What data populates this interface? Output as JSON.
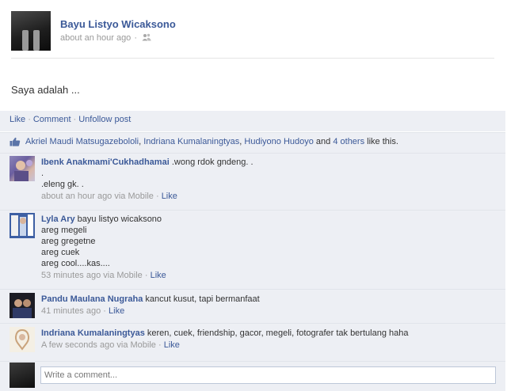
{
  "post": {
    "author": "Bayu Listyo Wicaksono",
    "timestamp": "about an hour ago",
    "meta_separator": "·",
    "audience_icon": "friends-icon",
    "text": "Saya adalah ..."
  },
  "actions": {
    "like": "Like",
    "comment": "Comment",
    "unfollow": "Unfollow post",
    "separator": "·"
  },
  "likes": {
    "icon": "thumbs-up-icon",
    "person1": "Akriel Maudi Matsugazebololi",
    "comma1": ",",
    "person2": "Indriana Kumalaningtyas",
    "comma2": ",",
    "person3": "Hudiyono Hudoyo",
    "and": "and",
    "others": "4 others",
    "suffix": "like this."
  },
  "comments": [
    {
      "author": "Ibenk Anakmami'Cukhadhamai",
      "text": ".wong rdok gndeng. .\n.\n.eleng gk. .",
      "time": "about an hour ago via Mobile",
      "sep": "·",
      "like": "Like"
    },
    {
      "author": "Lyla Ary",
      "text": "bayu listyo wicaksono\nareg megeli\nareg gregetne\nareg cuek\nareg cool....kas....",
      "time": "53 minutes ago via Mobile",
      "sep": "·",
      "like": "Like"
    },
    {
      "author": "Pandu Maulana Nugraha",
      "text": "kancut kusut, tapi bermanfaat",
      "time": "41 minutes ago",
      "sep": "·",
      "like": "Like"
    },
    {
      "author": "Indriana Kumalaningtyas",
      "text": "keren, cuek, friendship, gacor, megeli, fotografer tak bertulang haha",
      "time": "A few seconds ago via Mobile",
      "sep": "·",
      "like": "Like"
    }
  ],
  "composer": {
    "placeholder": "Write a comment..."
  },
  "colors": {
    "link": "#3b5998",
    "feedback_bg": "#edeff4",
    "meta": "#999999"
  }
}
